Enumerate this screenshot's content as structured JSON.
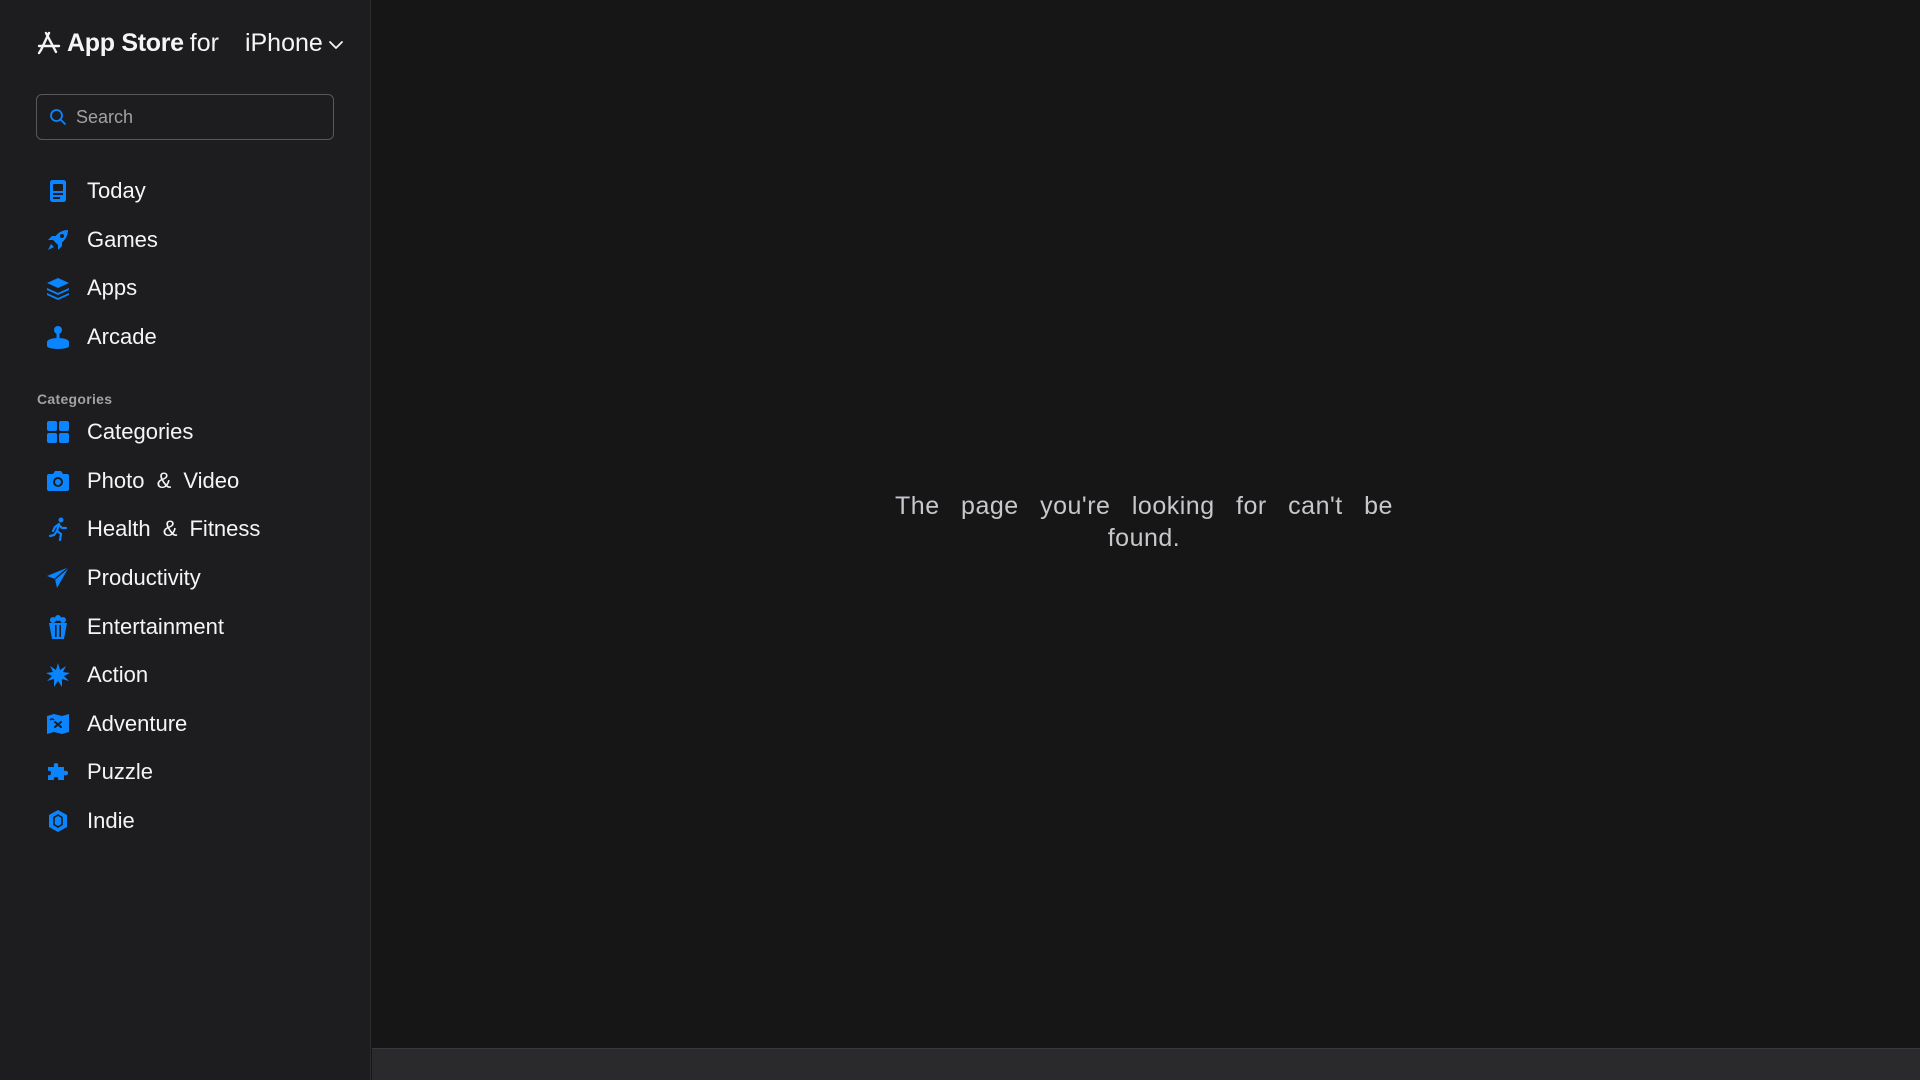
{
  "brand": {
    "name": "App Store",
    "for": "for",
    "platform": "iPhone"
  },
  "search": {
    "placeholder": "Search",
    "value": ""
  },
  "nav": {
    "main": [
      {
        "label": "Today",
        "icon": "today-icon"
      },
      {
        "label": "Games",
        "icon": "rocket-icon"
      },
      {
        "label": "Apps",
        "icon": "layers-icon"
      },
      {
        "label": "Arcade",
        "icon": "joystick-icon"
      }
    ],
    "categories_heading": "Categories",
    "categories": [
      {
        "label": "Categories",
        "icon": "grid-icon"
      },
      {
        "label": "Photo & Video",
        "icon": "camera-icon"
      },
      {
        "label": "Health & Fitness",
        "icon": "running-figure-icon"
      },
      {
        "label": "Productivity",
        "icon": "paper-plane-icon"
      },
      {
        "label": "Entertainment",
        "icon": "popcorn-icon"
      },
      {
        "label": "Action",
        "icon": "burst-icon"
      },
      {
        "label": "Adventure",
        "icon": "map-icon"
      },
      {
        "label": "Puzzle",
        "icon": "puzzle-piece-icon"
      },
      {
        "label": "Indie",
        "icon": "guitar-pick-icon"
      }
    ]
  },
  "main": {
    "message": "The page you're looking for can't be found."
  },
  "colors": {
    "accent": "#0a84ff",
    "sidebar_bg": "#1d1d1f",
    "main_bg": "#161617",
    "text": "#f5f5f7"
  }
}
